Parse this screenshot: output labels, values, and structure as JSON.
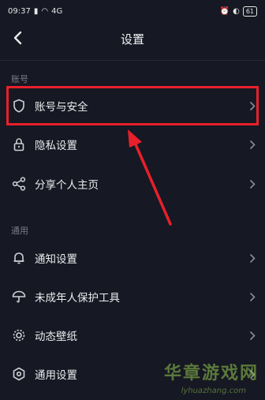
{
  "status": {
    "time": "09:37",
    "network": "4G",
    "battery": "61"
  },
  "header": {
    "title": "设置"
  },
  "sections": [
    {
      "title": "账号",
      "items": [
        {
          "label": "账号与安全",
          "icon": "shield-icon"
        },
        {
          "label": "隐私设置",
          "icon": "lock-icon"
        },
        {
          "label": "分享个人主页",
          "icon": "share-icon"
        }
      ]
    },
    {
      "title": "通用",
      "items": [
        {
          "label": "通知设置",
          "icon": "bell-icon"
        },
        {
          "label": "未成年人保护工具",
          "icon": "umbrella-icon"
        },
        {
          "label": "动态壁纸",
          "icon": "wallpaper-icon"
        },
        {
          "label": "通用设置",
          "icon": "hex-settings-icon"
        }
      ]
    }
  ],
  "colors": {
    "background": "#161823",
    "highlight": "#e8202b",
    "arrow": "#e8202b"
  },
  "watermark": {
    "text": "华章游戏网",
    "url": "lyhuazhang.com"
  }
}
